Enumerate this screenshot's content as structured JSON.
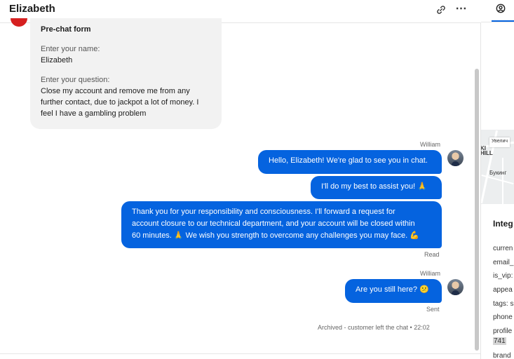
{
  "header": {
    "title": "Elizabeth"
  },
  "prechat": {
    "title": "Pre-chat form",
    "name_label": "Enter your name:",
    "name_value": "Elizabeth",
    "question_label": "Enter your question:",
    "question_lines": [
      "Close my account and remove me from any",
      "further contact, due to jackpot a lot of money. I",
      "feel I have a gambling problem"
    ]
  },
  "messages": [
    {
      "sender": "William",
      "lines": [
        "Hello, Elizabeth! We're glad to see you in chat."
      ]
    },
    {
      "lines": [
        "I'll do my best to assist you! 🙏"
      ]
    },
    {
      "lines": [
        "Thank you for your responsibility and consciousness. I'll forward a request for",
        "account closure to our technical department, and your account will be closed within",
        "60 minutes. 🙏 We wish you strength to overcome any challenges you may face. 💪"
      ],
      "status": "Read"
    },
    {
      "sender": "William",
      "lines": [
        "Are you still here? 😕"
      ],
      "status": "Sent"
    }
  ],
  "archived_note": "Archived - customer left the chat • 22:02",
  "side": {
    "map_zoom_label": "Увелич",
    "map_label_1": "HILL",
    "map_label_1b": "KI",
    "map_label_2": "Букинг",
    "integrations_title": "Integ",
    "fields": [
      "curren",
      "email_",
      "is_vip:",
      "appea",
      "tags: s",
      "phone",
      "profile"
    ],
    "highlight_value": "741",
    "last_field": "brand"
  },
  "colors": {
    "accent": "#0563df",
    "bubble_text": "#ffffff",
    "card_bg": "#f2f2f2",
    "red_avatar": "#d62020"
  }
}
